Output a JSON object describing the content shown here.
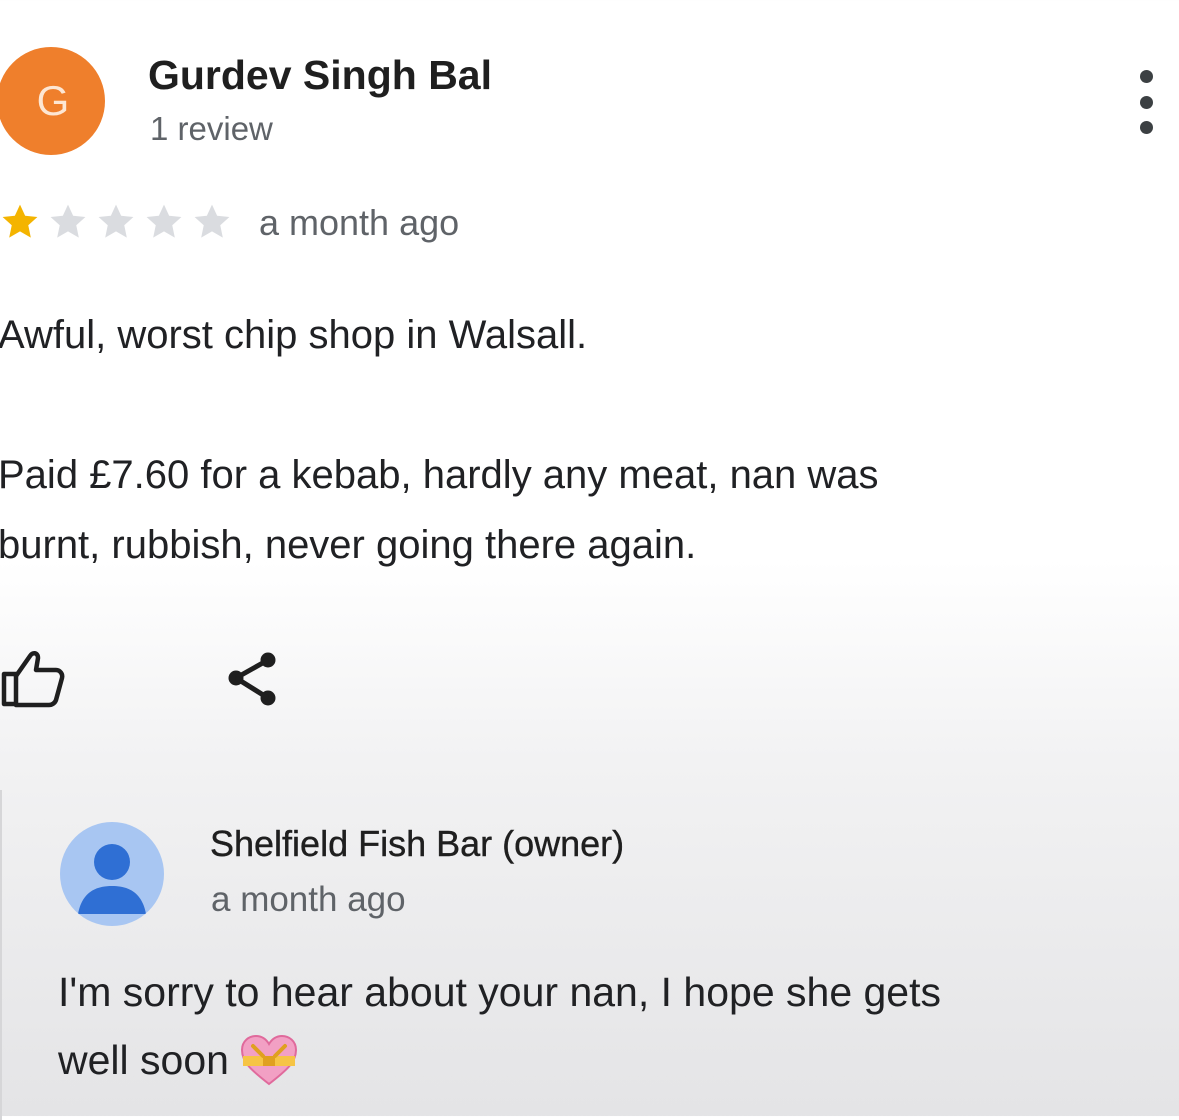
{
  "review": {
    "avatar_letter": "G",
    "avatar_color": "#ef7f2c",
    "author": "Gurdev Singh Bal",
    "author_meta": "1 review",
    "rating": 1,
    "rating_max": 5,
    "star_filled_color": "#f4b400",
    "star_empty_color": "#dadce0",
    "date": "a month ago",
    "text_lines": [
      "Awful, worst chip shop in Walsall.",
      "Paid £7.60 for a kebab, hardly any meat, nan was",
      "burnt, rubbish, never going there again."
    ],
    "actions": {
      "like_icon": "thumbs-up-icon",
      "share_icon": "share-icon",
      "more_icon": "more-vert-icon"
    }
  },
  "reply": {
    "avatar_icon": "person-icon",
    "avatar_color": "#a8c6f2",
    "author": "Shelfield Fish Bar (owner)",
    "date": "a month ago",
    "text_lines": [
      "I'm sorry to hear about your nan, I hope she gets",
      "well soon"
    ],
    "emoji": "heart-with-ribbon-emoji"
  }
}
